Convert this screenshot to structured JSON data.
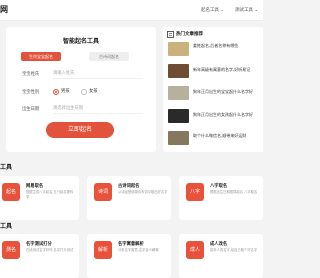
{
  "nav": {
    "logo_fragment": "网",
    "items": [
      {
        "label": "起名工具 ⌄"
      },
      {
        "label": "测试工具 ⌄"
      }
    ]
  },
  "naming_form": {
    "title": "智能起名工具",
    "tabs": [
      {
        "label": "生肖宝宝起名"
      },
      {
        "label": "古诗词起名"
      }
    ],
    "surname": {
      "label": "宝宝姓氏",
      "placeholder": "请输入姓氏"
    },
    "gender": {
      "label": "宝宝性别",
      "options": [
        {
          "label": "男孩"
        },
        {
          "label": "女孩"
        }
      ]
    },
    "birth_date": {
      "label": "出生日期",
      "placeholder": "请选择出生日期"
    },
    "submit_label": "立即起名"
  },
  "articles": {
    "title": "热门文章推荐",
    "items": [
      {
        "title": "姜姓起名,后者名称有哪些"
      },
      {
        "title": "新年高级有寓意的名字,好听易记"
      },
      {
        "title": "狗年正月出生的宝宝起什么名字好"
      },
      {
        "title": "狗年正月出生的女孩起什么名字好"
      },
      {
        "title": "取个什么微信名,顺带来好运财"
      }
    ]
  },
  "sections": [
    {
      "title": "取名工具",
      "tools": [
        {
          "icon_text": "起名",
          "name": "网易取名",
          "desc": "根据生辰八字起名,五行起名更科学"
        },
        {
          "icon_text": "诗词",
          "name": "古诗词起名",
          "desc": "从诗经楚辞唐诗宋词中取出好名字"
        },
        {
          "icon_text": "八字",
          "name": "八字取名",
          "desc": "根据出生日期推算起名 八字取名"
        }
      ]
    },
    {
      "title": "测试工具",
      "tools": [
        {
          "icon_text": "测名",
          "name": "名字测试打分",
          "desc": "在线测试名字好坏,名字打分测试"
        },
        {
          "icon_text": "解析",
          "name": "名字寓意解析",
          "desc": "分析名字寓意,名字含义解释"
        },
        {
          "icon_text": "成人",
          "name": "成人改名",
          "desc": "成年人改名字,给自己取个好名字"
        }
      ]
    }
  ],
  "colors": {
    "accent": "#e2533b",
    "background": "#f3f3f3"
  }
}
